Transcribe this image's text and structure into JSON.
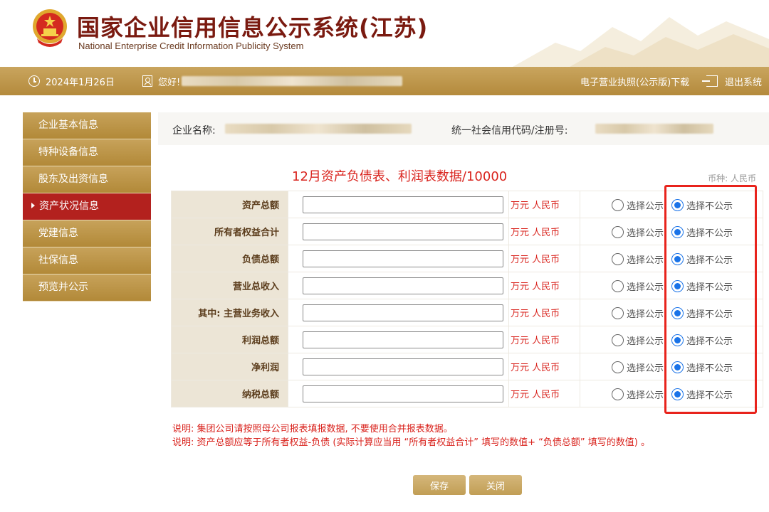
{
  "header": {
    "title_cn": "国家企业信用信息公示系统(江苏)",
    "title_en": "National Enterprise Credit Information Publicity System"
  },
  "topbar": {
    "date": "2024年1月26日",
    "greeting": "您好!",
    "license_download": "电子营业执照(公示版)下载",
    "logout": "退出系统"
  },
  "sidebar": {
    "items": [
      {
        "label": "企业基本信息",
        "active": false
      },
      {
        "label": "特种设备信息",
        "active": false
      },
      {
        "label": "股东及出资信息",
        "active": false
      },
      {
        "label": "资产状况信息",
        "active": true
      },
      {
        "label": "党建信息",
        "active": false
      },
      {
        "label": "社保信息",
        "active": false
      },
      {
        "label": "预览并公示",
        "active": false
      }
    ]
  },
  "info": {
    "company_name_label": "企业名称:",
    "credit_code_label": "统一社会信用代码/注册号:"
  },
  "form": {
    "title": "12月资产负债表、利润表数据/10000",
    "currency": "币种: 人民币",
    "unit": "万元 人民币",
    "option_public": "选择公示",
    "option_private": "选择不公示",
    "rows": [
      {
        "label": "资产总额",
        "value": "",
        "selected": "private"
      },
      {
        "label": "所有者权益合计",
        "value": "",
        "selected": "private"
      },
      {
        "label": "负债总额",
        "value": "",
        "selected": "private"
      },
      {
        "label": "营业总收入",
        "value": "",
        "selected": "private"
      },
      {
        "label": "其中: 主营业务收入",
        "value": "",
        "selected": "private"
      },
      {
        "label": "利润总额",
        "value": "",
        "selected": "private"
      },
      {
        "label": "净利润",
        "value": "",
        "selected": "private"
      },
      {
        "label": "纳税总额",
        "value": "",
        "selected": "private"
      }
    ]
  },
  "notes": [
    "说明: 集团公司请按照母公司报表填报数据, 不要使用合并报表数据。",
    "说明: 资产总额应等于所有者权益-负债 (实际计算应当用 “所有者权益合计” 填写的数值+ “负债总额” 填写的数值) 。"
  ],
  "buttons": {
    "save": "保存",
    "close": "关闭"
  },
  "colors": {
    "brand_dark": "#7a1a10",
    "gold": "#b48a3c",
    "active_red": "#b3211e",
    "accent_red": "#d9231d",
    "radio_blue": "#1a73e8"
  }
}
